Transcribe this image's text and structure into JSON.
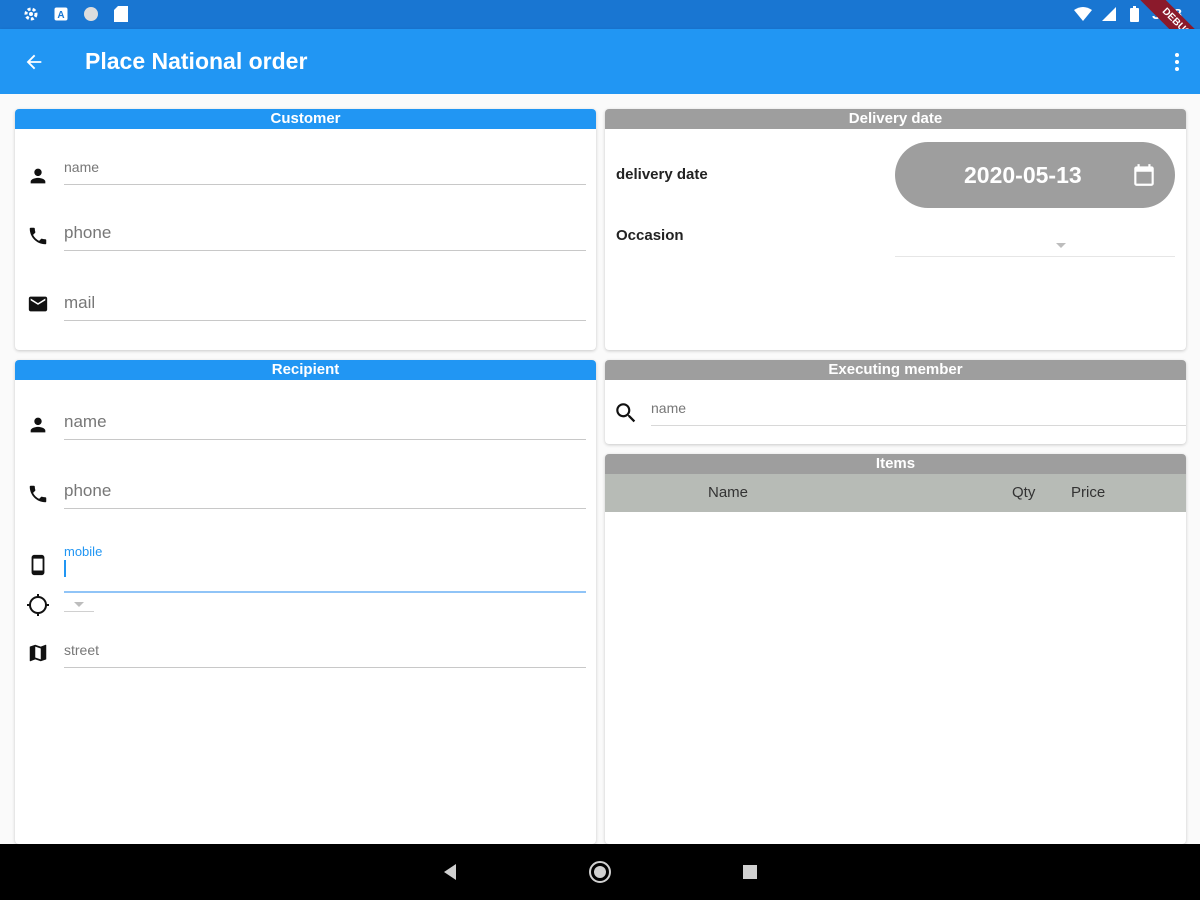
{
  "status_bar": {
    "time": "3:48",
    "debug_banner": "DEBUG",
    "left_icons": [
      "settings-icon",
      "a-icon",
      "circle-icon",
      "sd-card-icon"
    ],
    "right_icons": [
      "wifi-icon",
      "signal-icon",
      "battery-icon"
    ]
  },
  "app_bar": {
    "title": "Place National order",
    "back_icon": "arrow-back-icon",
    "menu_icon": "more-vert-icon"
  },
  "customer": {
    "header": "Customer",
    "name_placeholder": "name",
    "phone_placeholder": "phone",
    "mail_placeholder": "mail"
  },
  "delivery": {
    "header": "Delivery date",
    "date_label": "delivery date",
    "date_value": "2020-05-13",
    "occasion_label": "Occasion"
  },
  "recipient": {
    "header": "Recipient",
    "name_placeholder": "name",
    "phone_placeholder": "phone",
    "mobile_label": "mobile",
    "street_placeholder": "street"
  },
  "executing_member": {
    "header": "Executing member",
    "search_placeholder": "name"
  },
  "items": {
    "header": "Items",
    "columns": [
      "Name",
      "Qty",
      "Price"
    ],
    "rows": []
  },
  "colors": {
    "primary": "#2196f3",
    "primary_dark": "#1976d2",
    "header_grey": "#9e9e9e",
    "table_head": "#b7bbb6"
  }
}
